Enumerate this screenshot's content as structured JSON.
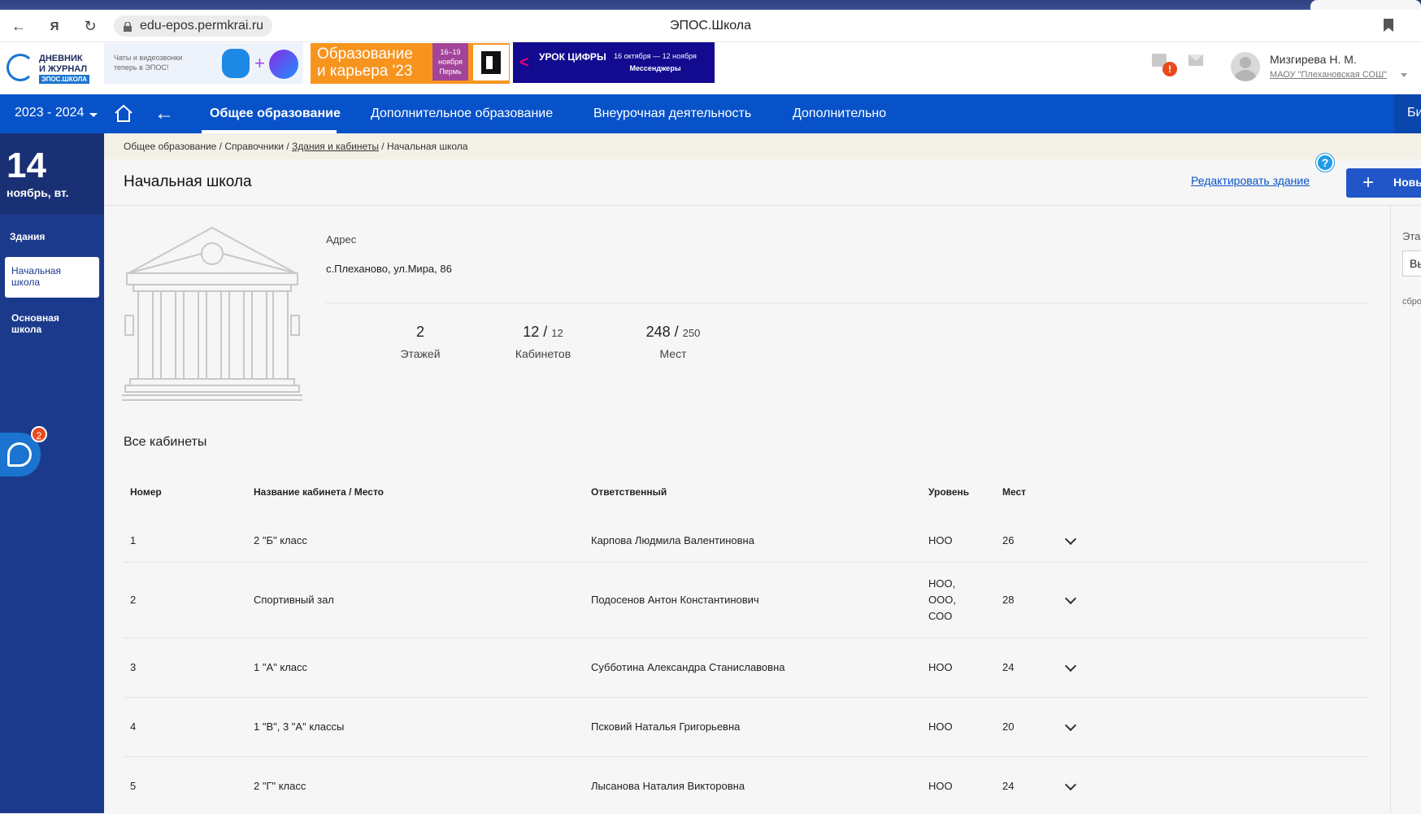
{
  "browser": {
    "url": "edu-epos.permkrai.ru",
    "tab_title": "ЭПОС.Школа"
  },
  "header": {
    "logo_line1": "ДНЕВНИК",
    "logo_line2": "И ЖУРНАЛ",
    "logo_line3": "ЭПОС.ШКОЛА",
    "banner_chat_text": "Чаты и видеозвонки теперь в ЭПОС!",
    "banner_edu_title_1": "Образование",
    "banner_edu_title_2": "и карьера '23",
    "banner_edu_date": "16–19 ноября Пермь",
    "banner_urok_title": "УРОК ЦИФРЫ",
    "banner_urok_dates": "16 октября — 12 ноября",
    "banner_urok_sub": "Мессенджеры",
    "notification_count": "!",
    "user_name": "Мизгирева Н. М.",
    "user_school": "МАОУ \"Плехановская СОШ\""
  },
  "nav": {
    "year": "2023 - 2024",
    "items": [
      {
        "label": "Общее образование"
      },
      {
        "label": "Дополнительное образование"
      },
      {
        "label": "Внеурочная деятельность"
      },
      {
        "label": "Дополнительно"
      }
    ],
    "right_button": "Би"
  },
  "sidebar": {
    "day": "14",
    "month_weekday": "ноябрь, вт.",
    "section": "Здания",
    "items": [
      {
        "label": "Начальная школа"
      },
      {
        "label": "Основная школа"
      }
    ],
    "helper_badge": "2"
  },
  "breadcrumb": {
    "part1": "Общее образование / Справочники / ",
    "link": "Здания и кабинеты",
    "part2": " / Начальная школа"
  },
  "page": {
    "title": "Начальная школа",
    "edit_link": "Редактировать здание",
    "help": "?",
    "new_button": "Новы",
    "address_label": "Адрес",
    "address_value": "с.Плеханово, ул.Мира, 86",
    "stats": {
      "floors_value": "2",
      "floors_label": "Этажей",
      "rooms_value": "12",
      "rooms_total": "12",
      "rooms_label": "Кабинетов",
      "seats_value": "248",
      "seats_total": "250",
      "seats_label": "Мест",
      "separator": " / "
    },
    "section_title": "Все кабинеты",
    "right_panel": {
      "label": "Эта",
      "select": "Вь",
      "reset": "сбро"
    }
  },
  "table": {
    "headers": {
      "number": "Номер",
      "name": "Название кабинета / Место",
      "responsible": "Ответственный",
      "level": "Уровень",
      "seats": "Мест"
    },
    "rows": [
      {
        "number": "1",
        "name": "2 \"Б\" класс",
        "responsible": "Карпова Людмила Валентиновна",
        "level": "НОО",
        "seats": "26"
      },
      {
        "number": "2",
        "name": "Спортивный зал",
        "responsible": "Подосенов Антон Константинович",
        "level": "НОО,\nООО,\nСОО",
        "seats": "28"
      },
      {
        "number": "3",
        "name": "1 \"А\" класс",
        "responsible": "Субботина Александра Станиславовна",
        "level": "НОО",
        "seats": "24"
      },
      {
        "number": "4",
        "name": "1 \"В\", 3 \"А\" классы",
        "responsible": "Псковий Наталья Григорьевна",
        "level": "НОО",
        "seats": "20"
      },
      {
        "number": "5",
        "name": "2 \"Г\" класс",
        "responsible": "Лысанова Наталия Викторовна",
        "level": "НОО",
        "seats": "24"
      }
    ]
  }
}
